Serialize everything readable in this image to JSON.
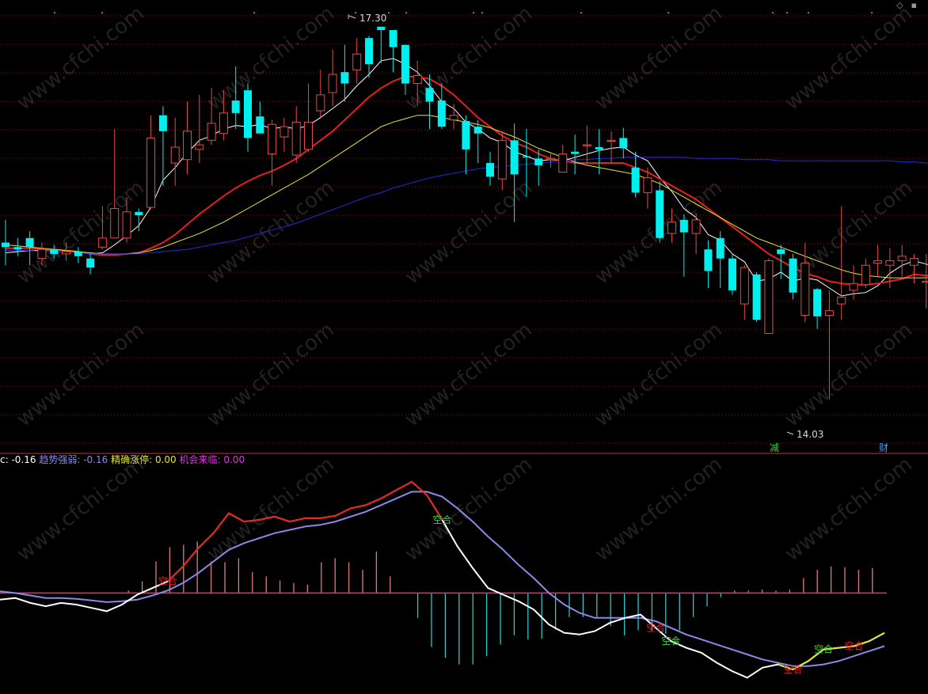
{
  "chart_data": [
    {
      "type": "candlestick",
      "price_min": 13.6,
      "price_max": 17.5,
      "annotations": {
        "high_label": "17.30",
        "low_label": "14.03"
      },
      "markers": [
        {
          "text": "减",
          "color": "#3ad23a"
        },
        {
          "text": "财",
          "color": "#3aa0ff"
        }
      ],
      "candles": [
        [
          15.4,
          15.36,
          15.6,
          15.2
        ],
        [
          15.36,
          15.34,
          15.44,
          15.28
        ],
        [
          15.44,
          15.36,
          15.5,
          15.2
        ],
        [
          15.26,
          15.34,
          15.4,
          15.2
        ],
        [
          15.34,
          15.3,
          15.38,
          15.26
        ],
        [
          15.3,
          15.32,
          15.4,
          15.24
        ],
        [
          15.32,
          15.28,
          15.36,
          15.22
        ],
        [
          15.26,
          15.18,
          15.3,
          15.12
        ],
        [
          15.36,
          15.44,
          15.72,
          15.34
        ],
        [
          15.44,
          15.7,
          16.4,
          15.44
        ],
        [
          15.44,
          15.67,
          15.8,
          15.4
        ],
        [
          15.67,
          15.64,
          15.7,
          15.5
        ],
        [
          15.71,
          16.32,
          16.52,
          15.7
        ],
        [
          16.52,
          16.38,
          16.6,
          15.9
        ],
        [
          16.1,
          16.24,
          16.5,
          15.9
        ],
        [
          16.13,
          16.38,
          16.64,
          16.0
        ],
        [
          16.22,
          16.26,
          16.7,
          16.1
        ],
        [
          16.3,
          16.45,
          16.76,
          16.26
        ],
        [
          16.36,
          16.54,
          16.74,
          16.3
        ],
        [
          16.65,
          16.54,
          16.95,
          16.4
        ],
        [
          16.74,
          16.32,
          16.8,
          16.2
        ],
        [
          16.51,
          16.36,
          16.64,
          16.4
        ],
        [
          16.18,
          16.44,
          16.48,
          15.9
        ],
        [
          16.33,
          16.42,
          16.5,
          16.2
        ],
        [
          16.17,
          16.46,
          16.6,
          16.1
        ],
        [
          16.22,
          16.46,
          16.8,
          16.2
        ],
        [
          16.56,
          16.7,
          16.92,
          16.5
        ],
        [
          16.72,
          16.88,
          17.1,
          16.6
        ],
        [
          16.9,
          16.8,
          17.14,
          16.64
        ],
        [
          16.92,
          17.06,
          17.2,
          16.8
        ],
        [
          17.2,
          16.97,
          17.22,
          16.85
        ],
        [
          17.3,
          17.27,
          17.3,
          16.98
        ],
        [
          17.27,
          17.12,
          17.27,
          16.9
        ],
        [
          17.14,
          16.8,
          17.14,
          16.7
        ],
        [
          16.8,
          16.87,
          17.0,
          16.6
        ],
        [
          16.76,
          16.64,
          16.88,
          16.4
        ],
        [
          16.65,
          16.42,
          16.8,
          16.4
        ],
        [
          16.48,
          16.52,
          16.62,
          16.4
        ],
        [
          16.47,
          16.22,
          16.52,
          16.0
        ],
        [
          16.42,
          16.36,
          16.48,
          16.1
        ],
        [
          16.1,
          15.98,
          16.2,
          15.9
        ],
        [
          15.96,
          16.3,
          16.38,
          15.86
        ],
        [
          16.3,
          16.0,
          16.45,
          15.58
        ],
        [
          16.16,
          16.15,
          16.4,
          15.8
        ],
        [
          16.14,
          16.08,
          16.22,
          15.9
        ],
        [
          16.13,
          16.14,
          16.18,
          16.06
        ],
        [
          16.02,
          16.18,
          16.26,
          16.02
        ],
        [
          16.2,
          16.18,
          16.35,
          16.0
        ],
        [
          16.26,
          16.26,
          16.43,
          16.1
        ],
        [
          16.24,
          16.22,
          16.4,
          16.0
        ],
        [
          16.3,
          16.3,
          16.38,
          16.1
        ],
        [
          16.32,
          16.23,
          16.41,
          16.14
        ],
        [
          16.06,
          15.84,
          16.2,
          15.8
        ],
        [
          15.84,
          15.97,
          16.06,
          15.7
        ],
        [
          15.86,
          15.44,
          15.94,
          15.4
        ],
        [
          15.48,
          15.58,
          15.7,
          15.4
        ],
        [
          15.6,
          15.49,
          15.65,
          15.1
        ],
        [
          15.48,
          15.6,
          15.66,
          15.3
        ],
        [
          15.34,
          15.15,
          15.42,
          15.0
        ],
        [
          15.44,
          15.26,
          15.5,
          15.0
        ],
        [
          15.26,
          14.98,
          15.3,
          14.94
        ],
        [
          14.86,
          15.18,
          15.2,
          14.72
        ],
        [
          15.12,
          14.72,
          15.14,
          14.7
        ],
        [
          14.6,
          15.24,
          15.26,
          14.6
        ],
        [
          15.34,
          15.3,
          15.38,
          15.08
        ],
        [
          15.26,
          14.96,
          15.3,
          14.9
        ],
        [
          14.76,
          15.22,
          15.4,
          14.7
        ],
        [
          14.99,
          14.75,
          15.0,
          14.64
        ],
        [
          14.76,
          14.8,
          14.98,
          14.02
        ],
        [
          14.86,
          14.92,
          15.72,
          14.72
        ],
        [
          14.98,
          15.04,
          15.2,
          14.9
        ],
        [
          15.03,
          15.2,
          15.26,
          15.0
        ],
        [
          15.22,
          15.24,
          15.38,
          15.1
        ],
        [
          15.2,
          15.24,
          15.35,
          15.0
        ],
        [
          15.24,
          15.28,
          15.38,
          15.1
        ],
        [
          15.2,
          15.26,
          15.3,
          15.04
        ],
        [
          15.05,
          15.06,
          15.3,
          14.82
        ],
        [
          15.26,
          14.99,
          15.32,
          14.94
        ]
      ],
      "moving_averages": [
        {
          "name": "MA5",
          "color": "#ffffff",
          "values": [
            15.31,
            15.32,
            15.33,
            15.33,
            15.34,
            15.33,
            15.32,
            15.3,
            15.31,
            15.38,
            15.46,
            15.55,
            15.71,
            15.95,
            16.06,
            16.19,
            16.3,
            16.34,
            16.4,
            16.43,
            16.42,
            16.44,
            16.4,
            16.42,
            16.4,
            16.43,
            16.5,
            16.58,
            16.66,
            16.78,
            16.88,
            17.0,
            17.02,
            16.97,
            16.9,
            16.78,
            16.64,
            16.58,
            16.46,
            16.4,
            16.32,
            16.28,
            16.2,
            16.16,
            16.12,
            16.13,
            16.12,
            16.15,
            16.18,
            16.21,
            16.23,
            16.24,
            16.17,
            16.12,
            15.97,
            15.85,
            15.7,
            15.62,
            15.47,
            15.42,
            15.3,
            15.23,
            15.06,
            15.08,
            15.14,
            15.06,
            15.09,
            15.07,
            15.0,
            14.93,
            14.95,
            14.96,
            15.02,
            15.13,
            15.2,
            15.24,
            15.21,
            15.18
          ]
        },
        {
          "name": "MA10",
          "color": "#e81e1e",
          "values": [
            15.35,
            15.35,
            15.35,
            15.34,
            15.34,
            15.33,
            15.32,
            15.3,
            15.29,
            15.29,
            15.3,
            15.31,
            15.35,
            15.4,
            15.47,
            15.56,
            15.65,
            15.73,
            15.81,
            15.88,
            15.94,
            15.99,
            16.03,
            16.08,
            16.14,
            16.22,
            16.3,
            16.38,
            16.48,
            16.58,
            16.68,
            16.76,
            16.82,
            16.86,
            16.86,
            16.84,
            16.78,
            16.7,
            16.6,
            16.5,
            16.42,
            16.34,
            16.28,
            16.24,
            16.18,
            16.14,
            16.12,
            16.1,
            16.1,
            16.1,
            16.1,
            16.1,
            16.06,
            16.02,
            15.96,
            15.9,
            15.84,
            15.78,
            15.7,
            15.62,
            15.54,
            15.46,
            15.38,
            15.3,
            15.24,
            15.18,
            15.13,
            15.1,
            15.06,
            15.04,
            15.03,
            15.03,
            15.04,
            15.06,
            15.08,
            15.12,
            15.11,
            15.12
          ]
        },
        {
          "name": "MA20",
          "color": "#e6e632",
          "values": [
            15.38,
            15.37,
            15.36,
            15.35,
            15.34,
            15.33,
            15.32,
            15.31,
            15.3,
            15.3,
            15.3,
            15.31,
            15.33,
            15.36,
            15.4,
            15.44,
            15.48,
            15.53,
            15.58,
            15.64,
            15.7,
            15.76,
            15.82,
            15.88,
            15.94,
            16.0,
            16.07,
            16.14,
            16.21,
            16.28,
            16.35,
            16.42,
            16.46,
            16.49,
            16.52,
            16.52,
            16.5,
            16.48,
            16.46,
            16.44,
            16.41,
            16.37,
            16.33,
            16.28,
            16.23,
            16.19,
            16.15,
            16.11,
            16.08,
            16.06,
            16.04,
            16.02,
            16.0,
            15.96,
            15.92,
            15.86,
            15.8,
            15.74,
            15.68,
            15.62,
            15.56,
            15.5,
            15.44,
            15.4,
            15.36,
            15.32,
            15.28,
            15.24,
            15.2,
            15.16,
            15.13,
            15.11,
            15.1,
            15.09,
            15.09,
            15.09,
            15.09,
            15.1
          ]
        },
        {
          "name": "MA60",
          "color": "#2828d2",
          "values": [
            15.33,
            15.33,
            15.33,
            15.32,
            15.32,
            15.31,
            15.31,
            15.3,
            15.3,
            15.3,
            15.3,
            15.3,
            15.31,
            15.32,
            15.33,
            15.34,
            15.36,
            15.38,
            15.4,
            15.42,
            15.45,
            15.48,
            15.51,
            15.54,
            15.57,
            15.61,
            15.65,
            15.69,
            15.73,
            15.77,
            15.81,
            15.84,
            15.88,
            15.91,
            15.94,
            15.97,
            15.99,
            16.01,
            16.03,
            16.05,
            16.06,
            16.07,
            16.08,
            16.09,
            16.1,
            16.11,
            16.12,
            16.13,
            16.13,
            16.14,
            16.14,
            16.15,
            16.15,
            16.15,
            16.15,
            16.15,
            16.15,
            16.14,
            16.14,
            16.14,
            16.14,
            16.13,
            16.13,
            16.13,
            16.12,
            16.12,
            16.12,
            16.12,
            16.12,
            16.12,
            16.12,
            16.12,
            16.12,
            16.12,
            16.11,
            16.11,
            16.1,
            16.09
          ]
        }
      ]
    },
    {
      "type": "indicator",
      "ylim": [
        -1.15,
        1.5
      ],
      "header": [
        {
          "label": "c: -0.16",
          "color": "#ffffff"
        },
        {
          "label": "趋势强弱: -0.16",
          "color": "#8a8ae6"
        },
        {
          "label": "精确涨停: 0.00",
          "color": "#e6e632"
        },
        {
          "label": "机会来临: 0.00",
          "color": "#e632e6"
        }
      ],
      "series": [
        {
          "color": "#ffffff",
          "values": [
            -0.08,
            -0.06,
            -0.12,
            -0.16,
            -0.12,
            -0.14,
            -0.18,
            -0.22,
            -0.14,
            -0.02,
            0.06,
            0.14,
            0.32,
            0.54,
            0.72,
            0.96,
            0.86,
            0.88,
            0.92,
            0.86,
            0.9,
            0.9,
            0.93,
            1.02,
            1.06,
            1.14,
            1.24,
            1.34,
            1.18,
            0.88,
            0.56,
            0.3,
            0.06,
            -0.02,
            -0.1,
            -0.2,
            -0.38,
            -0.48,
            -0.5,
            -0.46,
            -0.36,
            -0.3,
            -0.26,
            -0.42,
            -0.58,
            -0.66,
            -0.72,
            -0.84,
            -0.94,
            -1.02,
            -0.9,
            -0.86,
            -0.92,
            -0.82,
            -0.68,
            -0.66,
            -0.64,
            -0.58,
            -0.48
          ]
        },
        {
          "color": "#8a8ae6",
          "values": [
            0.02,
            0.0,
            -0.03,
            -0.06,
            -0.06,
            -0.07,
            -0.09,
            -0.11,
            -0.1,
            -0.08,
            -0.03,
            0.03,
            0.12,
            0.24,
            0.38,
            0.52,
            0.6,
            0.66,
            0.72,
            0.76,
            0.8,
            0.82,
            0.86,
            0.92,
            0.98,
            1.06,
            1.14,
            1.22,
            1.22,
            1.16,
            1.02,
            0.86,
            0.68,
            0.52,
            0.34,
            0.18,
            0.0,
            -0.14,
            -0.24,
            -0.3,
            -0.3,
            -0.3,
            -0.3,
            -0.34,
            -0.42,
            -0.5,
            -0.56,
            -0.62,
            -0.68,
            -0.74,
            -0.8,
            -0.84,
            -0.88,
            -0.88,
            -0.86,
            -0.82,
            -0.76,
            -0.7,
            -0.64
          ]
        },
        {
          "color": "#e81e1e",
          "start": 11,
          "end": 29
        },
        {
          "color": "#e6e632",
          "start": 51,
          "end": 58
        }
      ],
      "bars": [
        0,
        0,
        0,
        0,
        0,
        0,
        0,
        0,
        0.03,
        0.14,
        0.38,
        0.55,
        0.58,
        0.62,
        0.38,
        0.37,
        0.42,
        0.25,
        0.2,
        0.15,
        0.12,
        0.1,
        0.37,
        0.42,
        0.37,
        0.28,
        0.5,
        0.2,
        0.0,
        -0.3,
        -0.65,
        -0.78,
        -0.86,
        -0.86,
        -0.76,
        -0.62,
        -0.51,
        -0.56,
        -0.55,
        -0.44,
        -0.29,
        -0.29,
        -0.29,
        -0.4,
        -0.51,
        -0.45,
        -0.45,
        -0.49,
        -0.45,
        -0.29,
        -0.16,
        -0.05,
        0.03,
        0.03,
        0.04,
        0.03,
        0.04,
        0.18,
        0.28,
        0.32,
        0.31,
        0.28,
        0.3
      ],
      "signals": [
        {
          "text": "空合",
          "color": "#e81e1e",
          "index": 11
        },
        {
          "text": "空合",
          "color": "#3ad23a",
          "index": 29
        },
        {
          "text": "空合",
          "color": "#e81e1e",
          "index": 43
        },
        {
          "text": "空合",
          "color": "#3ad23a",
          "index": 44
        },
        {
          "text": "空合",
          "color": "#e81e1e",
          "index": 52
        },
        {
          "text": "空合",
          "color": "#3ad23a",
          "index": 54
        },
        {
          "text": "空合",
          "color": "#e81e1e",
          "index": 56
        }
      ]
    }
  ],
  "watermark": "www.cfchi.com",
  "colors": {
    "up": "#e24a4a",
    "down": "#00f0f0",
    "grid": "#7a1a1a",
    "separator": "#c8323c",
    "zero_line": "#e6326e",
    "signal_dots": "#d02fd0"
  }
}
